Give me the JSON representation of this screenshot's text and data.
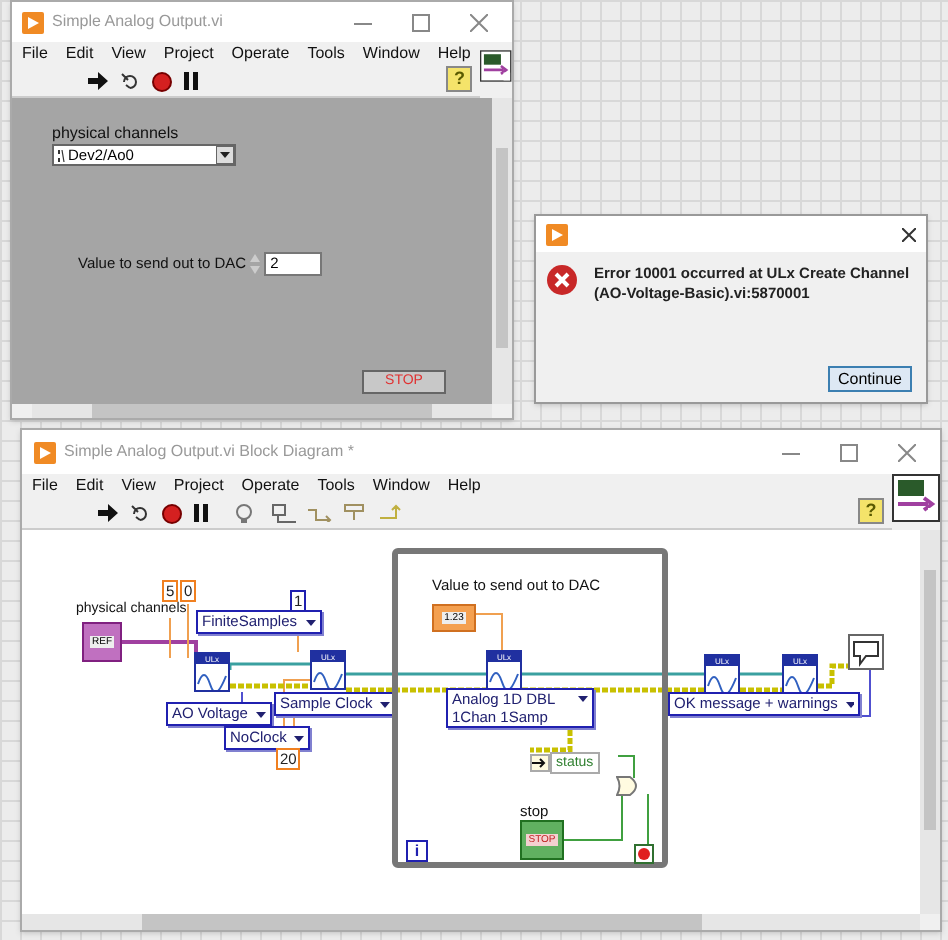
{
  "front_panel": {
    "title": "Simple Analog Output.vi",
    "menu": [
      "File",
      "Edit",
      "View",
      "Project",
      "Operate",
      "Tools",
      "Window",
      "Help"
    ],
    "physical_channels": {
      "label": "physical channels",
      "value": "Dev2/Ao0"
    },
    "dac_value": {
      "label": "Value to send out to DAC",
      "value": "2"
    },
    "stop_button": {
      "label": "STOP"
    },
    "help_text": "?"
  },
  "error_dialog": {
    "message": "Error 10001 occurred at ULx Create Channel (AO-Voltage-Basic).vi:5870001",
    "button": "Continue"
  },
  "block_diagram": {
    "title": "Simple Analog Output.vi Block Diagram *",
    "menu": [
      "File",
      "Edit",
      "View",
      "Project",
      "Operate",
      "Tools",
      "Window",
      "Help"
    ],
    "help_text": "?",
    "physical_channels_label": "physical channels",
    "ref_text": "REF",
    "range_max": "5",
    "range_min": "0",
    "samples_per_channel": "1",
    "sample_mode": "FiniteSamples",
    "ulx_nodes": [
      {
        "header": "ULx"
      },
      {
        "header": "ULx"
      },
      {
        "header": "ULx"
      },
      {
        "header": "ULx"
      },
      {
        "header": "ULx"
      }
    ],
    "channel_type": "AO Voltage",
    "timing_type": "Sample Clock",
    "clock_source": "NoClock",
    "rate": "20",
    "dac_label": "Value to send out to DAC",
    "numeric_text": "1.23",
    "write_mode": [
      "Analog 1D DBL",
      "1Chan 1Samp"
    ],
    "status_label": "status",
    "stop_label": "stop",
    "stop_text": "STOP",
    "iteration": "i",
    "error_mode": "OK message + warnings"
  }
}
